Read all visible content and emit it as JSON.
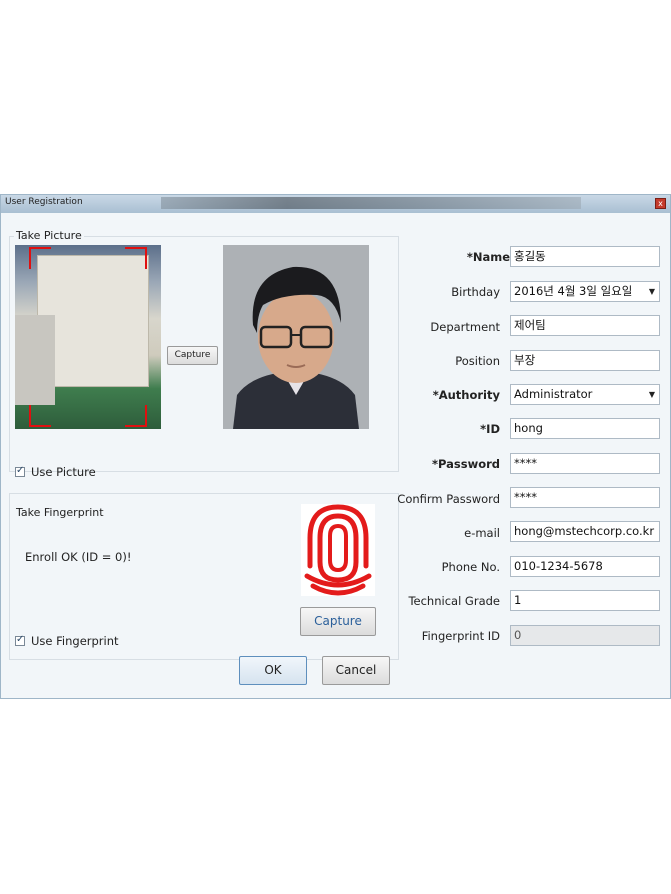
{
  "window": {
    "title": "User Registration",
    "close_label": "x"
  },
  "picture": {
    "group_label": "Take Picture",
    "capture_label": "Capture",
    "use_label": "Use Picture"
  },
  "fingerprint": {
    "group_label": "Take Fingerprint",
    "status": "Enroll OK (ID = 0)!",
    "capture_label": "Capture",
    "use_label": "Use Fingerprint"
  },
  "form": {
    "name": {
      "label": "*Name",
      "value": "홍길동"
    },
    "birthday": {
      "label": "Birthday",
      "value": "2016년   4월   3일 일요일"
    },
    "department": {
      "label": "Department",
      "value": "제어팀"
    },
    "position": {
      "label": "Position",
      "value": "부장"
    },
    "authority": {
      "label": "*Authority",
      "value": "Administrator"
    },
    "id": {
      "label": "*ID",
      "value": "hong"
    },
    "password": {
      "label": "*Password",
      "value": "****"
    },
    "confirm_password": {
      "label": "Confirm Password",
      "value": "****"
    },
    "email": {
      "label": "e-mail",
      "value": "hong@mstechcorp.co.kr"
    },
    "phone": {
      "label": "Phone No.",
      "value": "010-1234-5678"
    },
    "tech_grade": {
      "label": "Technical Grade",
      "value": "1"
    },
    "fingerprint_id": {
      "label": "Fingerprint ID",
      "value": "0"
    }
  },
  "buttons": {
    "ok": "OK",
    "cancel": "Cancel"
  },
  "colors": {
    "accent_red": "#e01010",
    "link_blue": "#2a5f9a"
  }
}
